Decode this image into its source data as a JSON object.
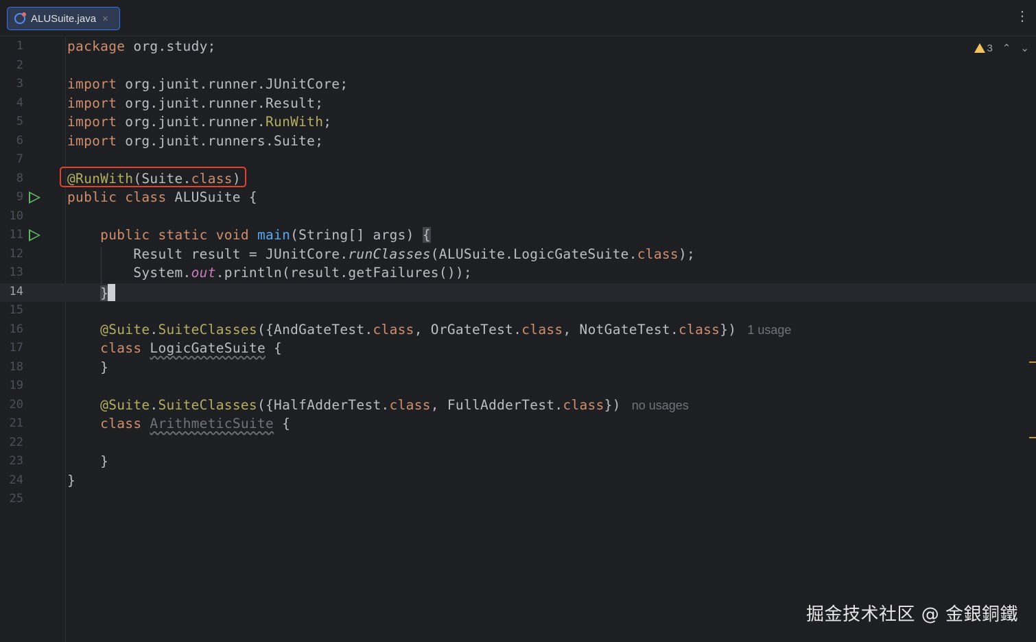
{
  "tab": {
    "title": "ALUSuite.java",
    "close": "×",
    "icon": "java-class-icon"
  },
  "toolbar": {
    "more": "⋮"
  },
  "inspections": {
    "warning_count": "3",
    "up": "⌃",
    "down": "⌄"
  },
  "lines": [
    {
      "n": "1",
      "html": "<span class=\"kw\">package</span> org.study;"
    },
    {
      "n": "2",
      "html": ""
    },
    {
      "n": "3",
      "html": "<span class=\"kw\">import</span> org.junit.runner.JUnitCore;"
    },
    {
      "n": "4",
      "html": "<span class=\"kw\">import</span> org.junit.runner.Result;"
    },
    {
      "n": "5",
      "html": "<span class=\"kw\">import</span> org.junit.runner.<span class=\"ann\">RunWith</span>;"
    },
    {
      "n": "6",
      "html": "<span class=\"kw\">import</span> org.junit.runners.Suite;"
    },
    {
      "n": "7",
      "html": ""
    },
    {
      "n": "8",
      "html": "<span class=\"ann\">@RunWith</span>(Suite.<span class=\"kw\">class</span>)"
    },
    {
      "n": "9",
      "html": "<span class=\"kw\">public class</span> ALUSuite {",
      "run": true
    },
    {
      "n": "10",
      "html": ""
    },
    {
      "n": "11",
      "html": "    <span class=\"kw\">public static void</span> <span class=\"fn\">main</span>(String[] args) <span class=\"match\">{</span>",
      "run": true
    },
    {
      "n": "12",
      "html": "        Result result = JUnitCore.<span class=\"it\">runClasses</span>(ALUSuite.LogicGateSuite.<span class=\"kw\">class</span>);"
    },
    {
      "n": "13",
      "html": "        System.<span class=\"st\">out</span>.println(result.getFailures());"
    },
    {
      "n": "14",
      "html": "    <span class=\"match\">}</span><span class=\"caret\"></span>",
      "current": true
    },
    {
      "n": "15",
      "html": ""
    },
    {
      "n": "16",
      "html": "    <span class=\"ann\">@Suite</span>.<span class=\"ann\">SuiteClasses</span>({AndGateTest.<span class=\"kw\">class</span>, OrGateTest.<span class=\"kw\">class</span>, NotGateTest.<span class=\"kw\">class</span>})<span class=\"hint\">1 usage</span>"
    },
    {
      "n": "17",
      "html": "    <span class=\"kw\">class</span> <span class=\"wavy\">LogicGateSuite</span> {"
    },
    {
      "n": "18",
      "html": "    }"
    },
    {
      "n": "19",
      "html": ""
    },
    {
      "n": "20",
      "html": "    <span class=\"ann\">@Suite</span>.<span class=\"ann\">SuiteClasses</span>({HalfAdderTest.<span class=\"kw\">class</span>, FullAdderTest.<span class=\"kw\">class</span>})<span class=\"hint\">no usages</span>"
    },
    {
      "n": "21",
      "html": "    <span class=\"kw\">class</span> <span class=\"wavy unused\">ArithmeticSuite</span> {"
    },
    {
      "n": "22",
      "html": ""
    },
    {
      "n": "23",
      "html": "    }"
    },
    {
      "n": "24",
      "html": "}"
    },
    {
      "n": "25",
      "html": ""
    }
  ],
  "watermark": "掘金技术社区 @ 金銀銅鐵"
}
